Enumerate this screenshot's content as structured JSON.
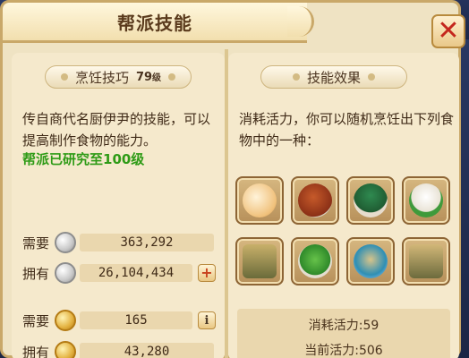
{
  "window": {
    "title": "帮派技能",
    "close_icon": "close-x-icon"
  },
  "skill": {
    "name": "烹饪技巧",
    "level_num": "79",
    "level_unit": "级",
    "description": "传自商代名厨伊尹的技能，可以提高制作食物的能力。",
    "research_status": "帮派已研究至100级"
  },
  "effect": {
    "header": "技能效果",
    "description": "消耗活力，你可以随机烹饪出下列食物中的一种：",
    "foods": [
      "steamed-buns-icon",
      "braised-meat-icon",
      "dish-with-cover-icon",
      "rice-dumpling-icon",
      "bronze-cauldron-icon",
      "green-cake-icon",
      "soup-bowl-icon",
      "bronze-vessel-icon"
    ]
  },
  "costs": {
    "silver": {
      "need_label": "需要",
      "need_value": "363,292",
      "have_label": "拥有",
      "have_value": "26,104,434",
      "icon": "silver-coin-icon",
      "add_icon": "plus-icon"
    },
    "gold": {
      "need_label": "需要",
      "need_value": "165",
      "have_label": "拥有",
      "have_value": "43,280",
      "icon": "gold-coin-icon",
      "info_icon": "info-icon"
    }
  },
  "vitality": {
    "cost_label": "消耗活力:",
    "cost_value": "59",
    "current_label": "当前活力:",
    "current_value": "506"
  },
  "colors": {
    "accent_green": "#2e9b16",
    "close_red": "#c4261d"
  }
}
